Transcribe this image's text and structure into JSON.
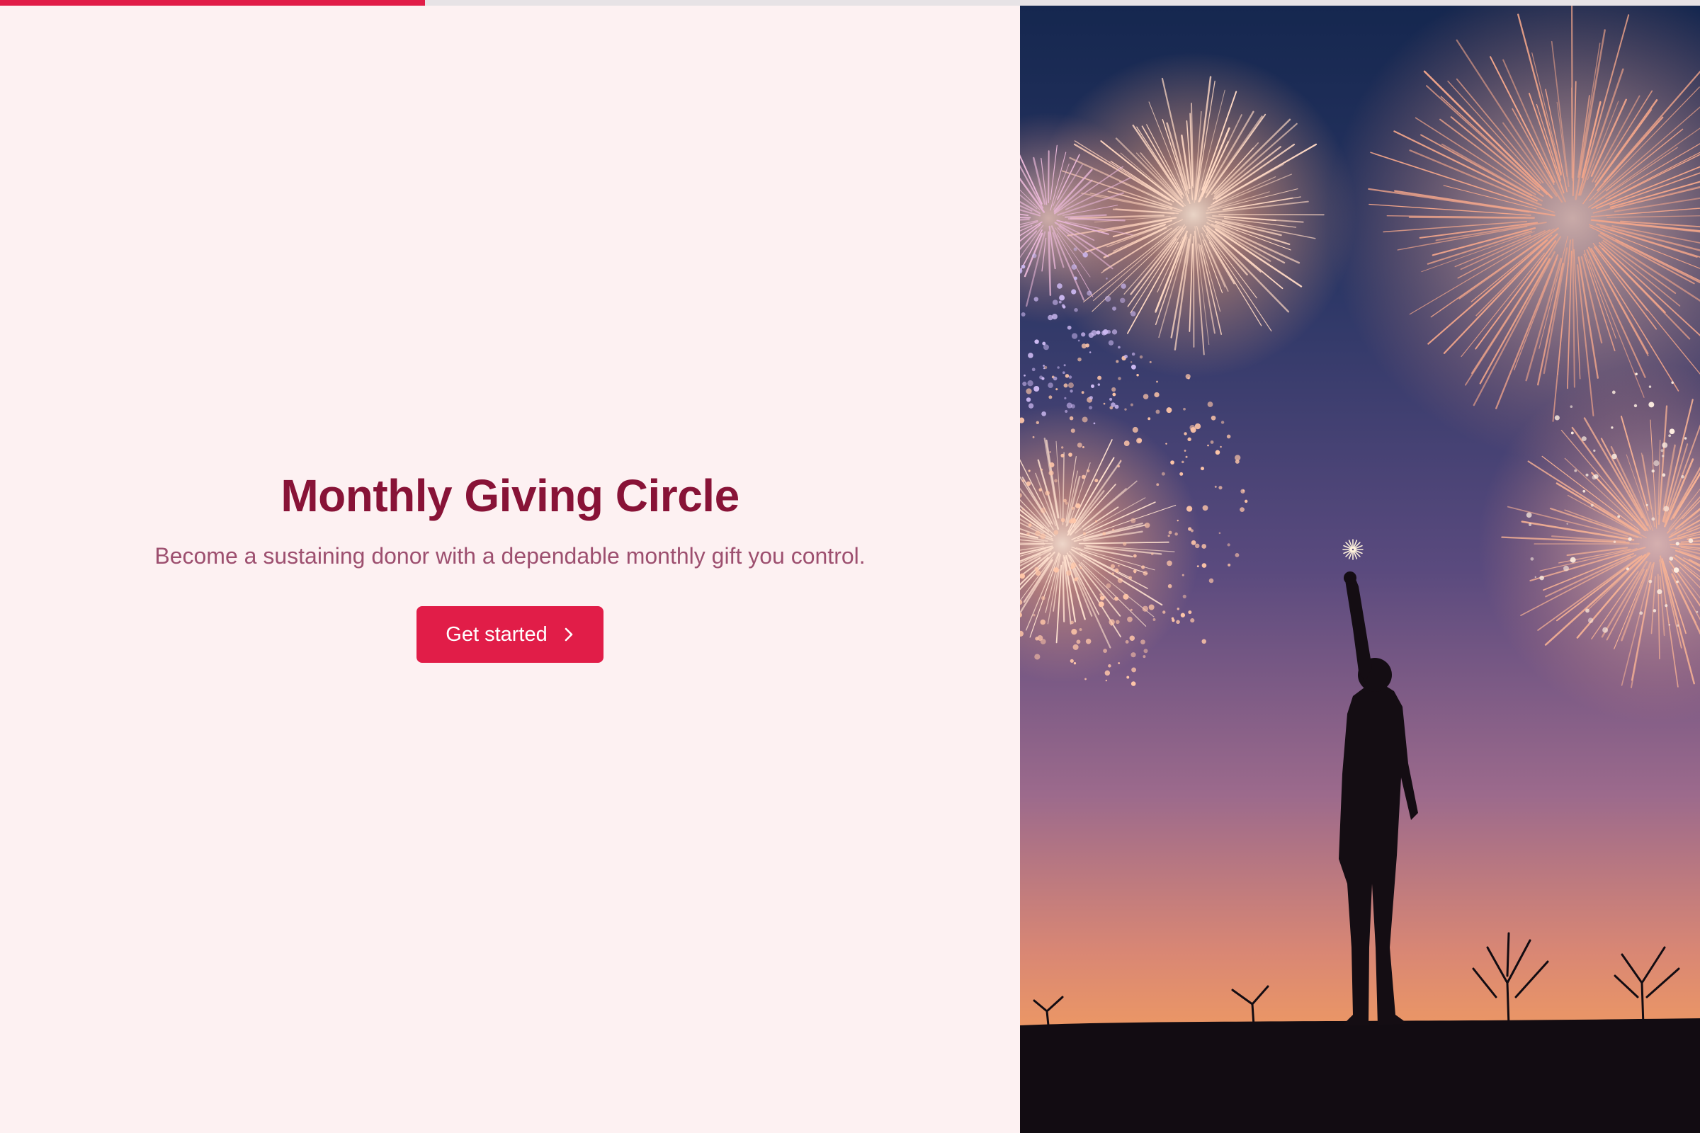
{
  "progress": {
    "fraction": 0.25,
    "color": "#e11d48"
  },
  "hero": {
    "title": "Monthly Giving Circle",
    "subtitle": "Become a sustaining donor with a dependable monthly gift you control.",
    "cta_label": "Get started",
    "cta_icon": "chevron-right-icon"
  },
  "colors": {
    "background": "#fdf1f2",
    "title": "#881337",
    "subtitle": "#9d4f6f",
    "accent": "#e11d48"
  },
  "image": {
    "subject": "fireworks-celebration-photo"
  }
}
